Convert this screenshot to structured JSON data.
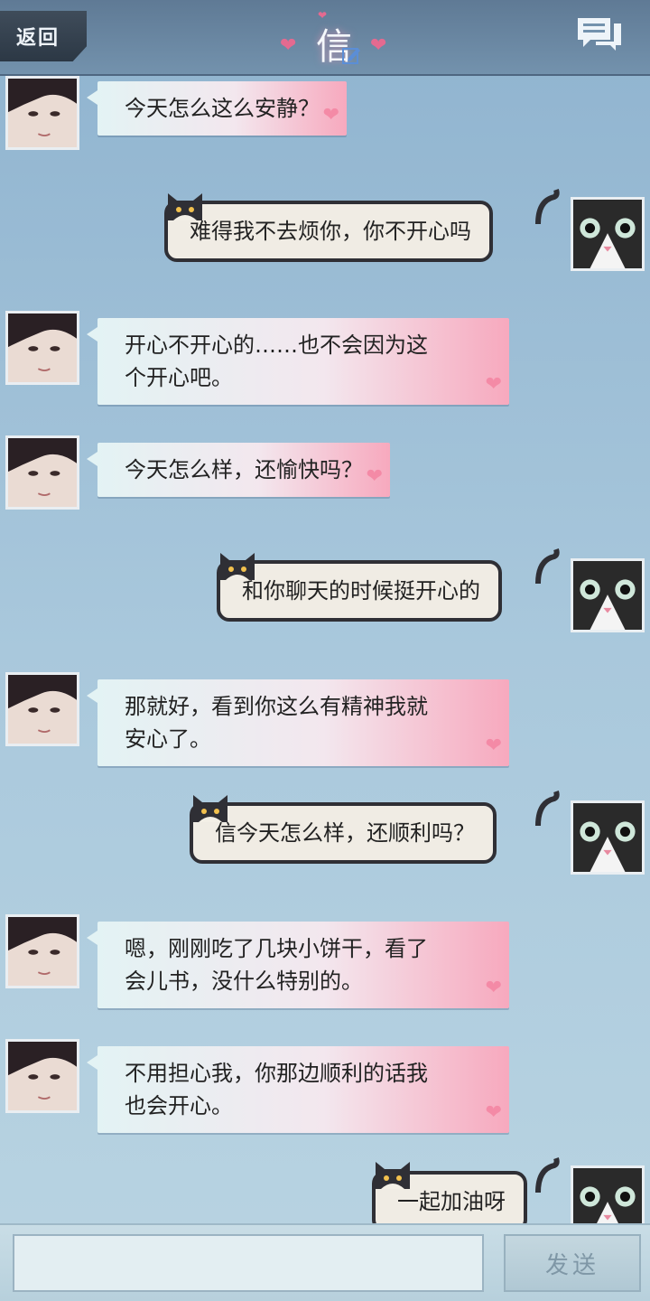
{
  "header": {
    "back_label": "返回",
    "title": "信"
  },
  "messages": [
    {
      "side": "left",
      "text": "今天怎么这么安静？"
    },
    {
      "side": "right",
      "text": "难得我不去烦你，你不开心吗"
    },
    {
      "side": "left",
      "lines": [
        "开心不开心的……也不会因为这",
        "个开心吧。"
      ]
    },
    {
      "side": "left",
      "text": "今天怎么样，还愉快吗？"
    },
    {
      "side": "right",
      "text": "和你聊天的时候挺开心的"
    },
    {
      "side": "left",
      "lines": [
        "那就好，看到你这么有精神我就",
        "安心了。"
      ]
    },
    {
      "side": "right",
      "text": "信今天怎么样，还顺利吗？"
    },
    {
      "side": "left",
      "lines": [
        "嗯，刚刚吃了几块小饼干，看了",
        "会儿书，没什么特别的。"
      ]
    },
    {
      "side": "left",
      "lines": [
        "不用担心我，你那边顺利的话我",
        "也会开心。"
      ]
    },
    {
      "side": "right",
      "text": "一起加油呀"
    }
  ],
  "input": {
    "send_label": "发送"
  },
  "colors": {
    "header": "#6a88a4",
    "left_bubble_start": "#e3f3f4",
    "left_bubble_end": "#f7a9be",
    "right_bubble": "#f0ece4",
    "right_bubble_border": "#2f2f35",
    "heart": "#f48aa6"
  },
  "icons": {
    "back": "back-button",
    "title_edit": "edit-icon",
    "chat": "chat-bubbles-icon",
    "bubble_decoration": "heart-icon",
    "right_bubble_decoration": "cat-icon"
  }
}
